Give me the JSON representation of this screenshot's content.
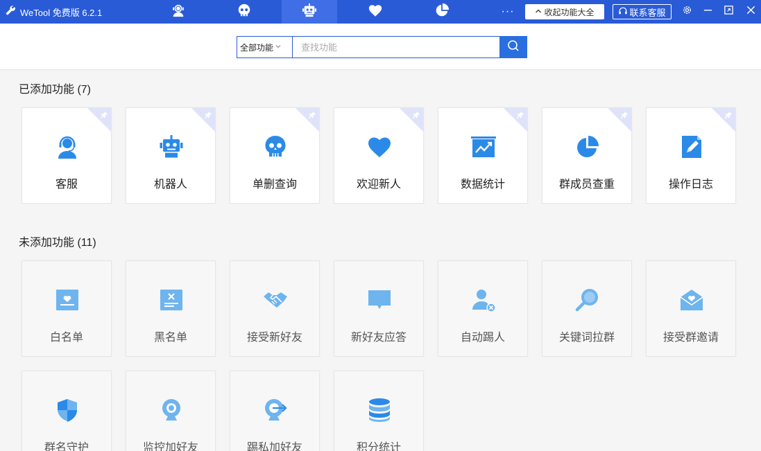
{
  "app": {
    "title": "WeTool 免费版 6.2.1"
  },
  "header": {
    "more_label": "···",
    "collapse_label": "收起功能大全",
    "collapse_arrow": "^",
    "contact_label": "联系客服"
  },
  "search": {
    "scope_value": "全部功能",
    "placeholder": "查找功能"
  },
  "added": {
    "title": "已添加功能 (7)",
    "items": [
      {
        "label": "客服",
        "icon": "customer-service-icon"
      },
      {
        "label": "机器人",
        "icon": "robot-icon"
      },
      {
        "label": "单删查询",
        "icon": "skull-icon"
      },
      {
        "label": "欢迎新人",
        "icon": "heart-icon"
      },
      {
        "label": "数据统计",
        "icon": "line-chart-icon"
      },
      {
        "label": "群成员查重",
        "icon": "pie-chart-icon"
      },
      {
        "label": "操作日志",
        "icon": "log-edit-icon"
      }
    ]
  },
  "not_added": {
    "title": "未添加功能 (11)",
    "items": [
      {
        "label": "白名单",
        "icon": "whitelist-icon"
      },
      {
        "label": "黑名单",
        "icon": "blacklist-icon"
      },
      {
        "label": "接受新好友",
        "icon": "handshake-icon"
      },
      {
        "label": "新好友应答",
        "icon": "chat-bubble-icon"
      },
      {
        "label": "自动踢人",
        "icon": "user-remove-icon"
      },
      {
        "label": "关键词拉群",
        "icon": "magnifier-icon"
      },
      {
        "label": "接受群邀请",
        "icon": "envelope-heart-icon"
      },
      {
        "label": "群名守护",
        "icon": "shield-icon"
      },
      {
        "label": "监控加好友",
        "icon": "webcam-icon"
      },
      {
        "label": "踢私加好友",
        "icon": "kick-arrow-icon"
      },
      {
        "label": "积分统计",
        "icon": "database-icon"
      }
    ]
  },
  "colors": {
    "titlebar": "#2a5bd7",
    "accent": "#2a6fe0",
    "icon_blue": "#2b8ae8",
    "icon_light": "#6eb4ef"
  }
}
